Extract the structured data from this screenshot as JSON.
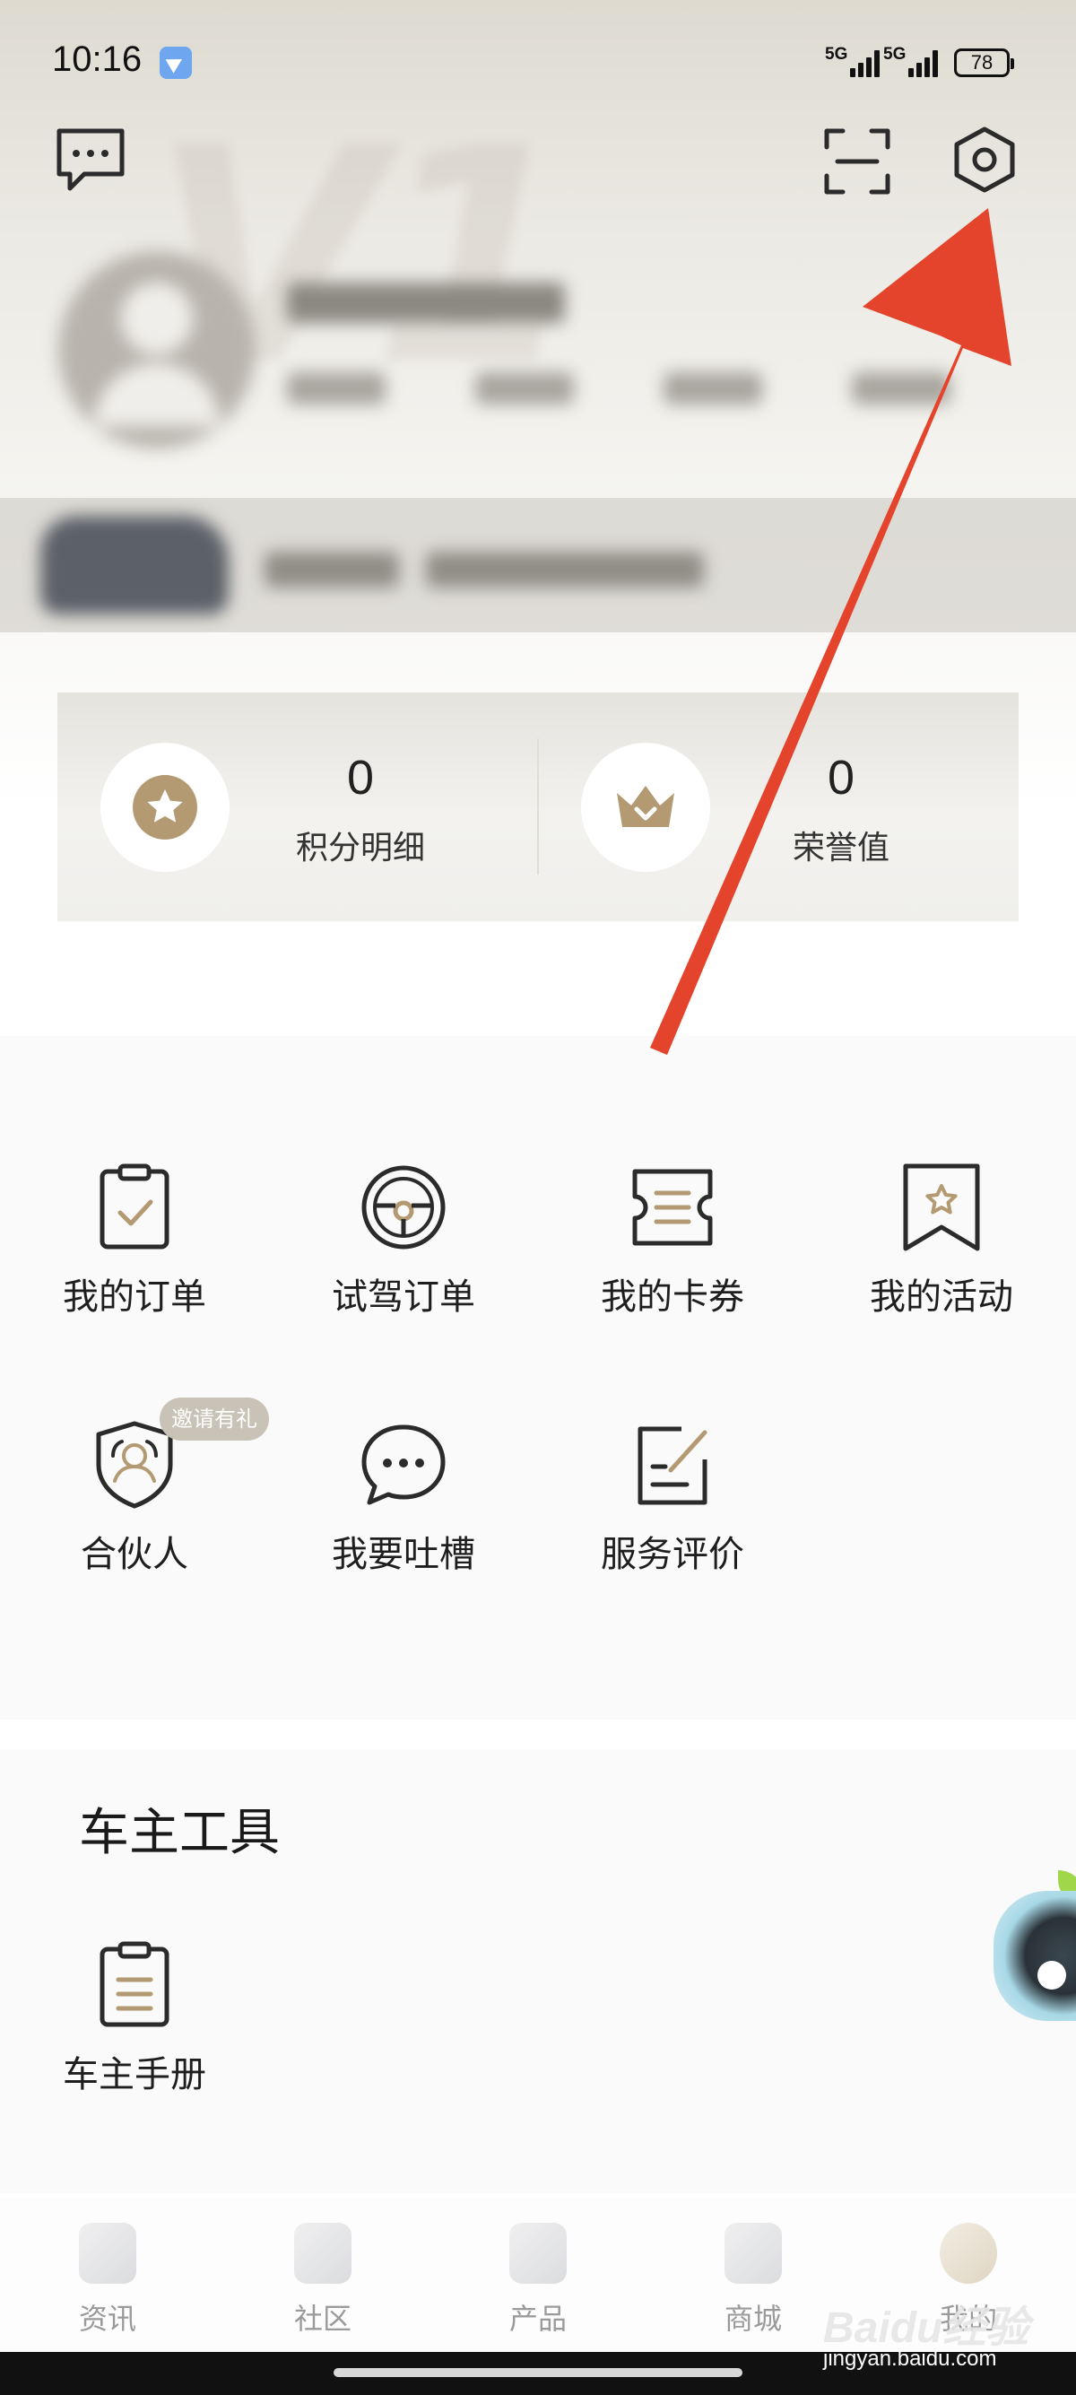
{
  "status_bar": {
    "time": "10:16",
    "network_1": "5G",
    "network_2": "5G",
    "battery": "78"
  },
  "header": {
    "watermark": "V1",
    "message_icon": "message-icon",
    "scan_icon": "scan-icon",
    "settings_icon": "settings-icon"
  },
  "points": {
    "points_value": "0",
    "points_label": "积分明细",
    "honor_value": "0",
    "honor_label": "荣誉值"
  },
  "grid": {
    "items": [
      {
        "label": "我的订单",
        "icon": "clipboard-check-icon"
      },
      {
        "label": "试驾订单",
        "icon": "steering-wheel-icon"
      },
      {
        "label": "我的卡券",
        "icon": "coupon-icon"
      },
      {
        "label": "我的活动",
        "icon": "bookmark-star-icon"
      },
      {
        "label": "合伙人",
        "icon": "partner-shield-icon"
      },
      {
        "label": "我要吐槽",
        "icon": "chat-bubble-icon"
      },
      {
        "label": "服务评价",
        "icon": "edit-note-icon"
      }
    ],
    "badge": "邀请有礼"
  },
  "tools": {
    "title": "车主工具",
    "items": [
      {
        "label": "车主手册",
        "icon": "manual-icon"
      }
    ]
  },
  "bottom_nav": {
    "items": [
      {
        "label": "资讯"
      },
      {
        "label": "社区"
      },
      {
        "label": "产品"
      },
      {
        "label": "商城"
      },
      {
        "label": "我的"
      }
    ]
  },
  "watermark": {
    "brand": "Baidu经验",
    "url": "jingyan.baidu.com"
  },
  "colors": {
    "accent_gold": "#b39a72",
    "annotation_arrow": "#e3442b",
    "icon_stroke": "#2b2b2b"
  }
}
